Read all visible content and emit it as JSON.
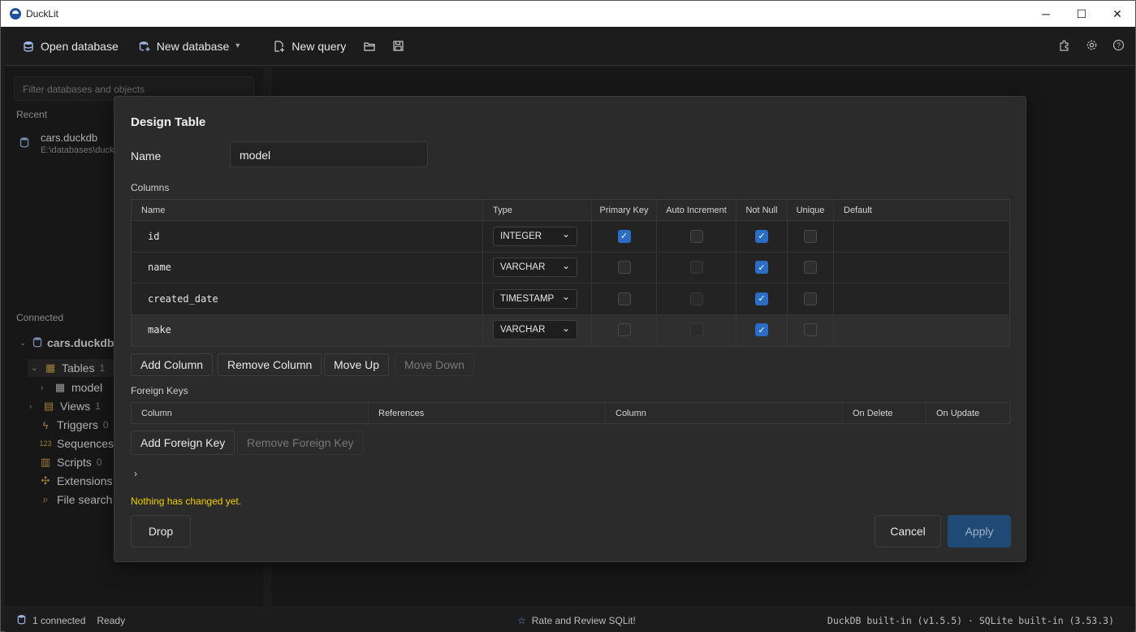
{
  "window": {
    "title": "DuckLit",
    "minimize_glyph": "─",
    "maximize_glyph": "☐",
    "close_glyph": "✕"
  },
  "toolbar": {
    "open_database": "Open database",
    "new_database": "New database",
    "new_query": "New query",
    "icons": [
      "database-icon",
      "new-database-icon",
      "chevron-down-icon",
      "new-query-icon",
      "folder-open-icon",
      "save-icon",
      "extensions-icon",
      "settings-icon",
      "help-icon"
    ]
  },
  "sidebar": {
    "filter_placeholder": "Filter databases and objects",
    "recent_label": "Recent",
    "recent": [
      {
        "name": "cars.duckdb",
        "path": "E:\\databases\\duckd"
      }
    ],
    "connected_label": "Connected",
    "db_name": "cars.duckdb",
    "tree": {
      "tables": {
        "label": "Tables",
        "count": "1"
      },
      "model": {
        "label": "model"
      },
      "views": {
        "label": "Views",
        "count": "1"
      },
      "triggers": {
        "label": "Triggers",
        "count": "0"
      },
      "sequences": {
        "label": "Sequences"
      },
      "scripts": {
        "label": "Scripts",
        "count": "0"
      },
      "extensions": {
        "label": "Extensions"
      },
      "file_search": {
        "label": "File search"
      }
    }
  },
  "dialog": {
    "title": "Design Table",
    "name_label": "Name",
    "name_value": "model",
    "columns_label": "Columns",
    "headers": {
      "name": "Name",
      "type": "Type",
      "primary_key": "Primary Key",
      "auto_increment": "Auto Increment",
      "not_null": "Not Null",
      "unique": "Unique",
      "default": "Default"
    },
    "rows": [
      {
        "name": "id",
        "type": "INTEGER",
        "primary_key": true,
        "auto_increment": false,
        "auto_increment_enabled": true,
        "not_null": true,
        "unique": false,
        "default": ""
      },
      {
        "name": "name",
        "type": "VARCHAR",
        "primary_key": false,
        "auto_increment": false,
        "auto_increment_enabled": false,
        "not_null": true,
        "unique": false,
        "default": ""
      },
      {
        "name": "created_date",
        "type": "TIMESTAMP",
        "primary_key": false,
        "auto_increment": false,
        "auto_increment_enabled": false,
        "not_null": true,
        "unique": false,
        "default": ""
      },
      {
        "name": "make",
        "type": "VARCHAR",
        "primary_key": false,
        "auto_increment": false,
        "auto_increment_enabled": false,
        "not_null": true,
        "unique": false,
        "default": ""
      }
    ],
    "buttons": {
      "add_column": "Add Column",
      "remove_column": "Remove Column",
      "move_up": "Move Up",
      "move_down": "Move Down",
      "add_fk": "Add Foreign Key",
      "remove_fk": "Remove Foreign Key",
      "drop": "Drop",
      "cancel": "Cancel",
      "apply": "Apply"
    },
    "fk_label": "Foreign Keys",
    "fk_headers": {
      "column": "Column",
      "references": "References",
      "ref_column": "Column",
      "on_delete": "On Delete",
      "on_update": "On Update"
    },
    "expander_glyph": "›",
    "notice": "Nothing has changed yet."
  },
  "statusbar": {
    "connected": "1 connected",
    "state": "Ready",
    "rate": "Rate and Review SQLit!",
    "versions": "DuckDB built-in (v1.5.5) · SQLite built-in (3.53.3)"
  },
  "colors": {
    "accent": "#2b6cc4",
    "notice": "#f2d000",
    "apply_bg": "#1f4a75"
  }
}
